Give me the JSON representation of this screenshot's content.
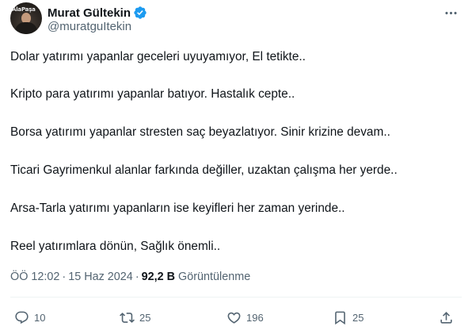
{
  "author": {
    "display_name": "Murat Gültekin",
    "handle": "@muratguItekin",
    "avatar_text": "AlaPaşa",
    "verified_icon": "verified-badge-icon",
    "verified_color": "#1d9bf0"
  },
  "tweet": {
    "lines": [
      "Dolar yatırımı yapanlar geceleri uyuyamıyor, El tetikte..",
      "Kripto para yatırımı yapanlar batıyor. Hastalık cepte..",
      "Borsa yatırımı yapanlar stresten saç beyazlatıyor. Sinir krizine devam..",
      "Ticari Gayrimenkul alanlar farkında değiller, uzaktan çalışma her yerde..",
      "Arsa-Tarla yatırımı yapanların ise keyifleri her zaman yerinde..",
      "Reel yatırımlara dönün, Sağlık önemli.."
    ]
  },
  "meta": {
    "time": "ÖÖ 12:02",
    "date": "15 Haz 2024",
    "separator": "·",
    "views_count": "92,2 B",
    "views_label": "Görüntülenme"
  },
  "actions": {
    "reply": {
      "icon": "reply-icon",
      "count": "10"
    },
    "retweet": {
      "icon": "retweet-icon",
      "count": "25"
    },
    "like": {
      "icon": "heart-icon",
      "count": "196"
    },
    "bookmark": {
      "icon": "bookmark-icon",
      "count": "25"
    },
    "share": {
      "icon": "share-icon"
    }
  },
  "more_icon": "more-options-icon"
}
